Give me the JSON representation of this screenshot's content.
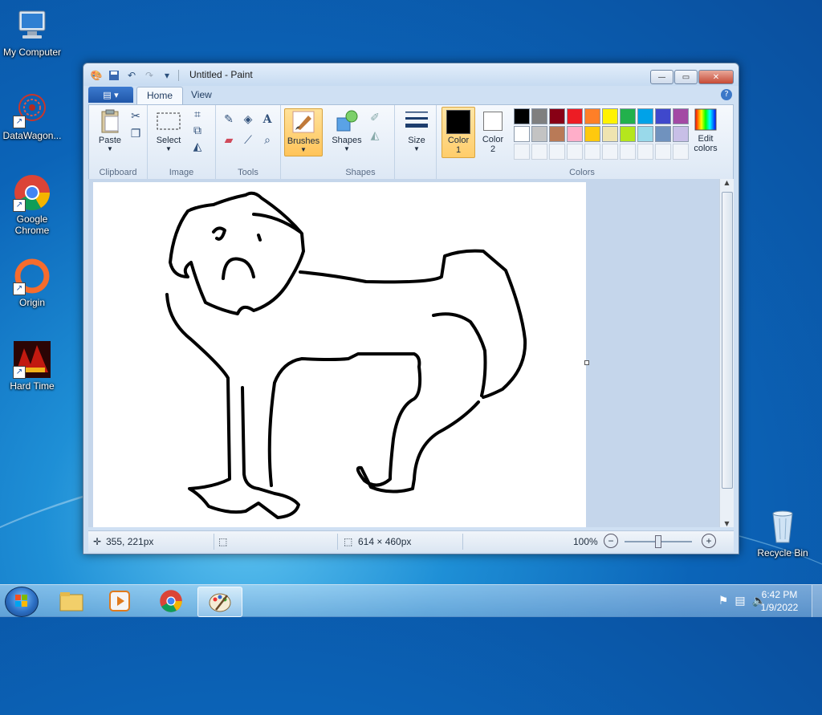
{
  "desktop": {
    "icons": [
      {
        "label": "My Computer"
      },
      {
        "label": "DataWagon..."
      },
      {
        "label": "Google Chrome"
      },
      {
        "label": "Origin"
      },
      {
        "label": "Hard Time"
      },
      {
        "label": "Recycle Bin"
      }
    ]
  },
  "window": {
    "title": "Untitled - Paint",
    "tabs": {
      "file": "▤ ▾",
      "home": "Home",
      "view": "View"
    },
    "ribbon": {
      "clipboard": {
        "paste": "Paste",
        "group": "Clipboard"
      },
      "image": {
        "select": "Select",
        "group": "Image"
      },
      "tools": {
        "group": "Tools"
      },
      "brushes": {
        "label": "Brushes"
      },
      "shapes": {
        "label": "Shapes",
        "group": "Shapes"
      },
      "size": {
        "label": "Size"
      },
      "color1": {
        "label": "Color",
        "num": "1"
      },
      "color2": {
        "label": "Color",
        "num": "2"
      },
      "colors": {
        "group": "Colors",
        "edit": "Edit",
        "edit2": "colors"
      },
      "palette_row1": [
        "#000000",
        "#7f7f7f",
        "#880015",
        "#ed1c24",
        "#ff7f27",
        "#fff200",
        "#22b14c",
        "#00a2e8",
        "#3f48cc",
        "#a349a4"
      ],
      "palette_row2": [
        "#ffffff",
        "#c3c3c3",
        "#b97a57",
        "#ffaec9",
        "#ffc90e",
        "#efe4b0",
        "#b5e61d",
        "#99d9ea",
        "#7092be",
        "#c8bfe7"
      ],
      "selected_color1": "#000000",
      "selected_color2": "#ffffff"
    },
    "status": {
      "cursor": "355, 221px",
      "size": "614 × 460px",
      "zoom": "100%"
    }
  },
  "taskbar": {
    "clock_time": "6:42 PM",
    "clock_date": "1/9/2022"
  }
}
